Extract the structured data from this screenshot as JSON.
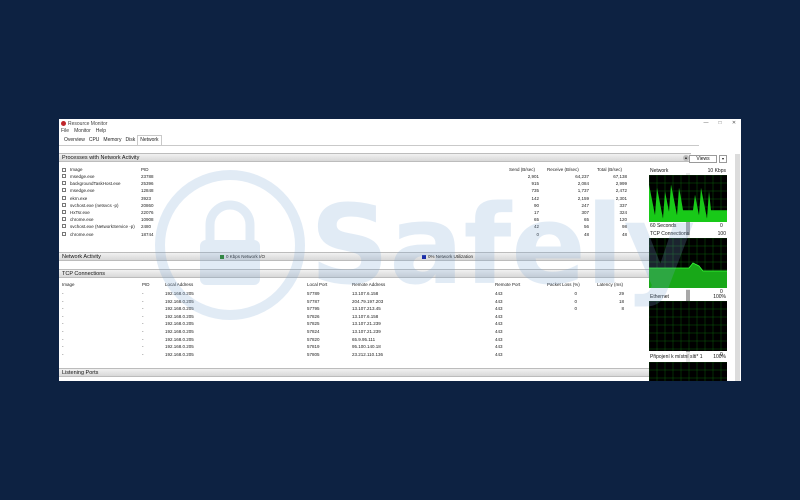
{
  "window": {
    "title": "Resource Monitor",
    "controls": [
      "—",
      "□",
      "✕"
    ]
  },
  "menu": [
    "File",
    "Monitor",
    "Help"
  ],
  "tabs": [
    "Overview",
    "CPU",
    "Memory",
    "Disk",
    "Network"
  ],
  "active_tab": "Network",
  "processes": {
    "title": "Processes with Network Activity",
    "columns": [
      "Image",
      "PID",
      "Send (B/sec)",
      "Receive (B/sec)",
      "Total (B/sec)"
    ],
    "rows": [
      [
        "msedge.exe",
        "23788",
        "2,901",
        "64,237",
        "67,138"
      ],
      [
        "backgroundTaskHost.exe",
        "25396",
        "915",
        "2,084",
        "2,999"
      ],
      [
        "msedge.exe",
        "12848",
        "735",
        "1,737",
        "2,472"
      ],
      [
        "ekrn.exe",
        "3923",
        "142",
        "2,159",
        "2,301"
      ],
      [
        "svchost.exe (netsvcs -p)",
        "20860",
        "90",
        "247",
        "337"
      ],
      [
        "HxTsr.exe",
        "22076",
        "17",
        "307",
        "324"
      ],
      [
        "chrome.exe",
        "10908",
        "65",
        "65",
        "120"
      ],
      [
        "svchost.exe (NetworkService -p)",
        "2480",
        "42",
        "56",
        "98"
      ],
      [
        "chrome.exe",
        "18744",
        "0",
        "48",
        "48"
      ]
    ]
  },
  "network_activity": {
    "title": "Network Activity",
    "io_label": "0 Kbps Network I/O",
    "util_label": "0% Network Utilization",
    "io_color": "#1e7d1e",
    "util_color": "#1c2fa8"
  },
  "tcp": {
    "title": "TCP Connections",
    "columns": [
      "Image",
      "PID",
      "Local Address",
      "Local Port",
      "Remote Address",
      "Remote Port",
      "Packet Loss (%)",
      "Latency (ms)"
    ],
    "rows": [
      [
        "-",
        "-",
        "192.168.0.205",
        "57789",
        "13.107.6.158",
        "443",
        "0",
        "29"
      ],
      [
        "-",
        "-",
        "192.168.0.205",
        "57787",
        "204.79.197.203",
        "443",
        "0",
        "18"
      ],
      [
        "-",
        "-",
        "192.168.0.205",
        "57795",
        "13.107.213.45",
        "443",
        "0",
        "8"
      ],
      [
        "-",
        "-",
        "192.168.0.205",
        "57826",
        "13.107.6.158",
        "443",
        "",
        ""
      ],
      [
        "-",
        "-",
        "192.168.0.205",
        "57825",
        "13.107.21.239",
        "443",
        "",
        ""
      ],
      [
        "-",
        "-",
        "192.168.0.205",
        "57824",
        "13.107.21.239",
        "443",
        "",
        ""
      ],
      [
        "-",
        "-",
        "192.168.0.205",
        "57820",
        "65.9.95.111",
        "443",
        "",
        ""
      ],
      [
        "-",
        "-",
        "192.168.0.205",
        "57819",
        "95.100.140.18",
        "443",
        "",
        ""
      ],
      [
        "-",
        "-",
        "192.168.0.205",
        "57805",
        "23.212.110.136",
        "443",
        "",
        ""
      ]
    ]
  },
  "listening_ports": {
    "title": "Listening Ports"
  },
  "side_panel": {
    "views_label": "Views",
    "graphs": [
      {
        "name": "Network",
        "value": "10 Kbps",
        "bottom_left": "60 Seconds",
        "bottom_right": "0"
      },
      {
        "name": "TCP Connections",
        "value": "100",
        "bottom_left": "",
        "bottom_right": "0"
      },
      {
        "name": "Ethernet",
        "value": "100%",
        "bottom_left": "",
        "bottom_right": "0"
      },
      {
        "name": "Připojení k místní síti* 1",
        "value": "100%",
        "bottom_left": "",
        "bottom_right": ""
      }
    ]
  },
  "watermark": "Safely"
}
